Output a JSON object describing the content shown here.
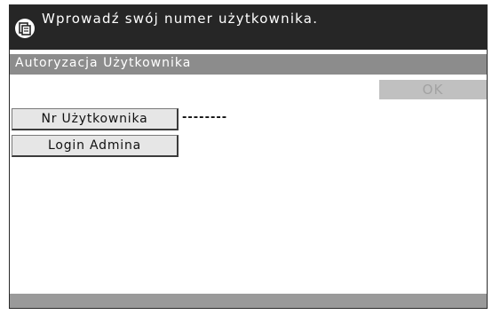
{
  "message": {
    "icon": "copier-icon",
    "text": "Wprowadź swój numer użytkownika."
  },
  "screen": {
    "title": "Autoryzacja Użytkownika"
  },
  "actions": {
    "ok_label": "OK"
  },
  "fields": {
    "user_number_label": "Nr Użytkownika",
    "user_number_value": "--------",
    "admin_login_label": "Login Admina"
  }
}
